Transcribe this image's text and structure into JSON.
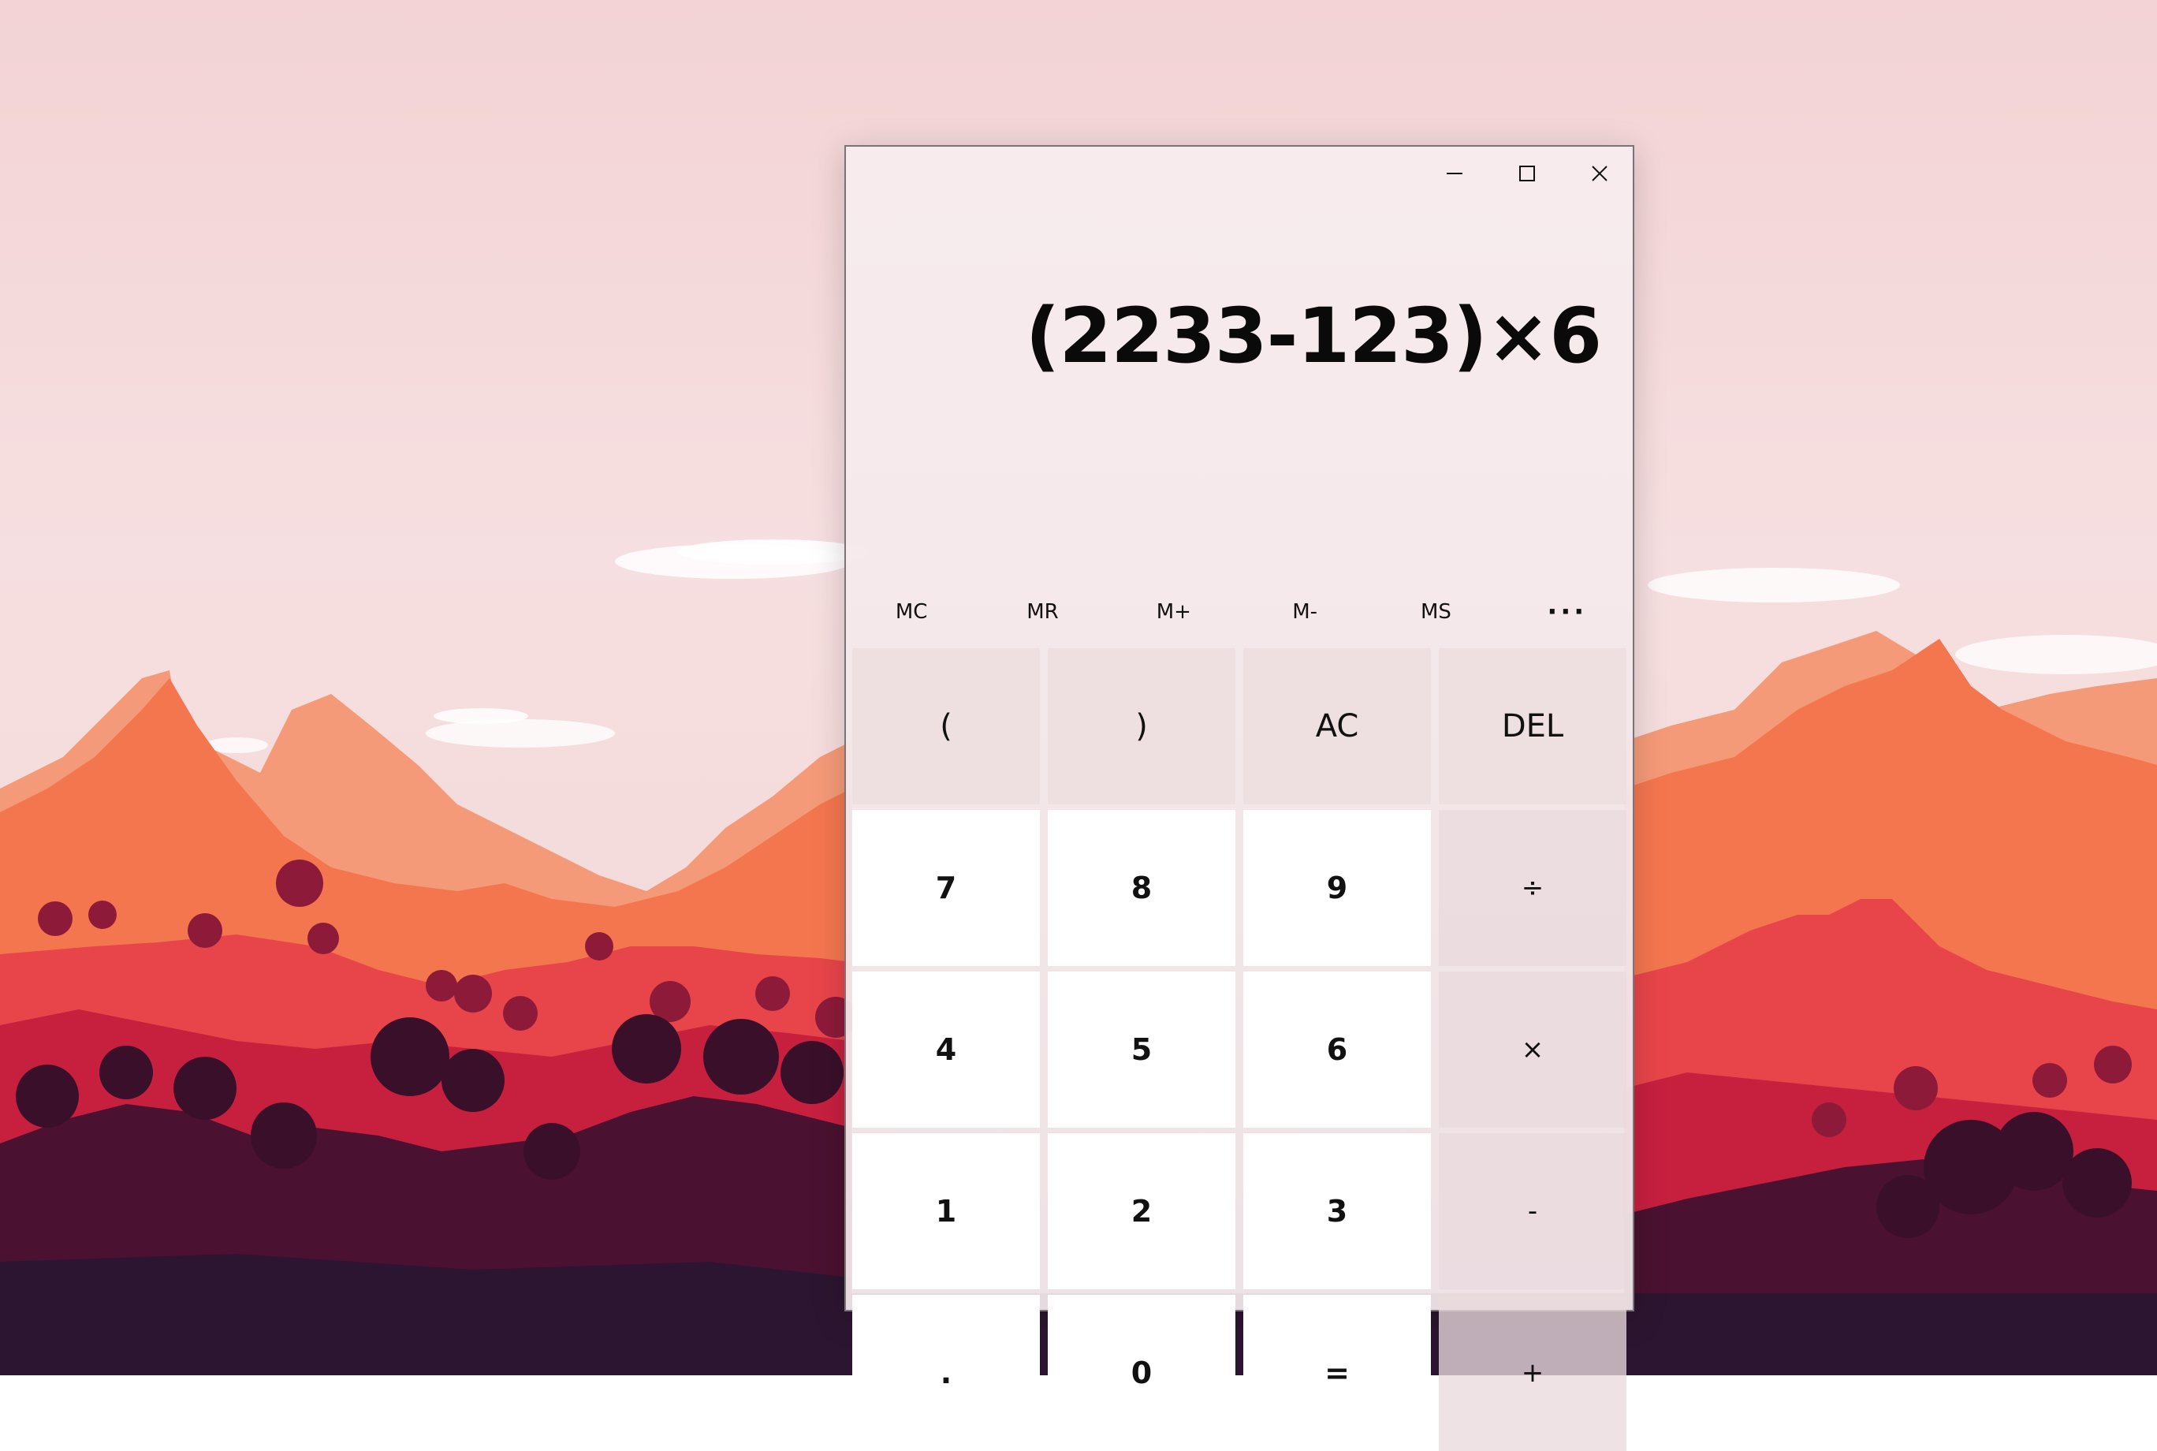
{
  "window": {
    "controls": {
      "minimize_icon": "minimize-icon",
      "maximize_icon": "maximize-icon",
      "close_icon": "close-icon"
    }
  },
  "display": {
    "expression": "(2233-123)×6"
  },
  "memory": {
    "mc": "MC",
    "mr": "MR",
    "m_plus": "M+",
    "m_minus": "M-",
    "ms": "MS",
    "more": "···"
  },
  "keys": {
    "open_paren": "(",
    "close_paren": ")",
    "ac": "AC",
    "del": "DEL",
    "seven": "7",
    "eight": "8",
    "nine": "9",
    "divide": "÷",
    "four": "4",
    "five": "5",
    "six": "6",
    "multiply": "×",
    "one": "1",
    "two": "2",
    "three": "3",
    "minus": "-",
    "decimal": ".",
    "zero": "0",
    "equals": "=",
    "plus": "+"
  },
  "colors": {
    "sky": "#f3d3d5",
    "mountain_far": "#f59a78",
    "mountain_mid": "#f4764f",
    "hills_red": "#e8454a",
    "hills_crimson": "#c7203f",
    "foreground_dark": "#4a1230",
    "foreground_darkest": "#2c1530",
    "number_key_bg": "#ffffff",
    "text": "#111111"
  }
}
